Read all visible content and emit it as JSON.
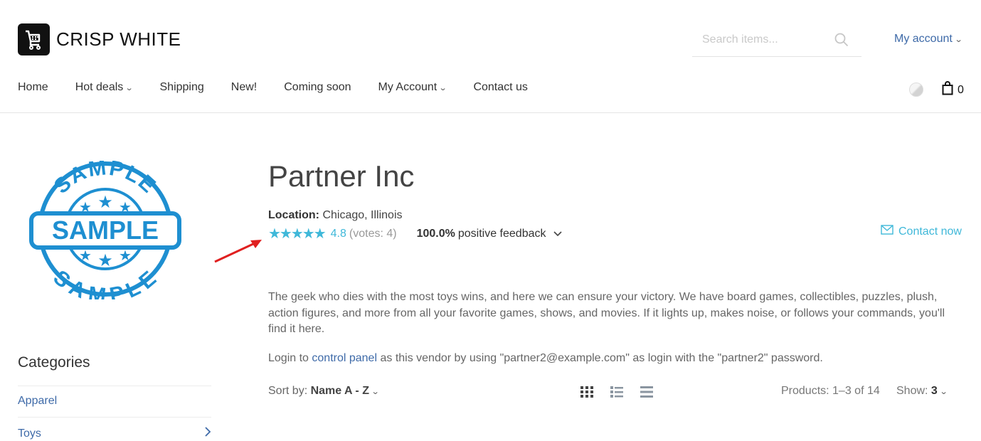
{
  "header": {
    "logo_text": "CRISP WHITE",
    "search_placeholder": "Search items...",
    "my_account": "My account",
    "cart_count": "0"
  },
  "nav": {
    "items": [
      {
        "label": "Home",
        "dropdown": false
      },
      {
        "label": "Hot deals",
        "dropdown": true
      },
      {
        "label": "Shipping",
        "dropdown": false
      },
      {
        "label": "New!",
        "dropdown": false
      },
      {
        "label": "Coming soon",
        "dropdown": false
      },
      {
        "label": "My Account",
        "dropdown": true
      },
      {
        "label": "Contact us",
        "dropdown": false
      }
    ]
  },
  "sidebar": {
    "logo_top": "SAMPLE",
    "logo_center": "SAMPLE",
    "logo_bottom": "SAMPLE",
    "categories_title": "Categories",
    "categories": [
      {
        "label": "Apparel"
      },
      {
        "label": "Toys"
      }
    ]
  },
  "vendor": {
    "name": "Partner Inc",
    "location_label": "Location:",
    "location_value": "Chicago, Illinois",
    "rating": "4.8",
    "rating_stars": 4.8,
    "votes": "(votes: 4)",
    "feedback_percent": "100.0%",
    "feedback_text": "positive feedback",
    "contact_now": "Contact now",
    "description": "The geek who dies with the most toys wins, and here we can ensure your victory. We have board games, collectibles, puzzles, plush, action figures, and more from all your favorite games, shows, and movies. If it lights up, makes noise, or follows your commands, you'll find it here.",
    "login_prefix": "Login to",
    "login_link": "control panel",
    "login_suffix": "as this vendor by using \"partner2@example.com\" as login with the \"partner2\" password."
  },
  "toolbar": {
    "sort_label": "Sort by:",
    "sort_value": "Name A - Z",
    "products_count": "Products: 1–3 of 14",
    "show_label": "Show:",
    "show_value": "3"
  },
  "colors": {
    "accent": "#3fb8d9",
    "link": "#3e6aa8",
    "stamp": "#1e8fd1",
    "annotation_arrow": "#e02020"
  }
}
